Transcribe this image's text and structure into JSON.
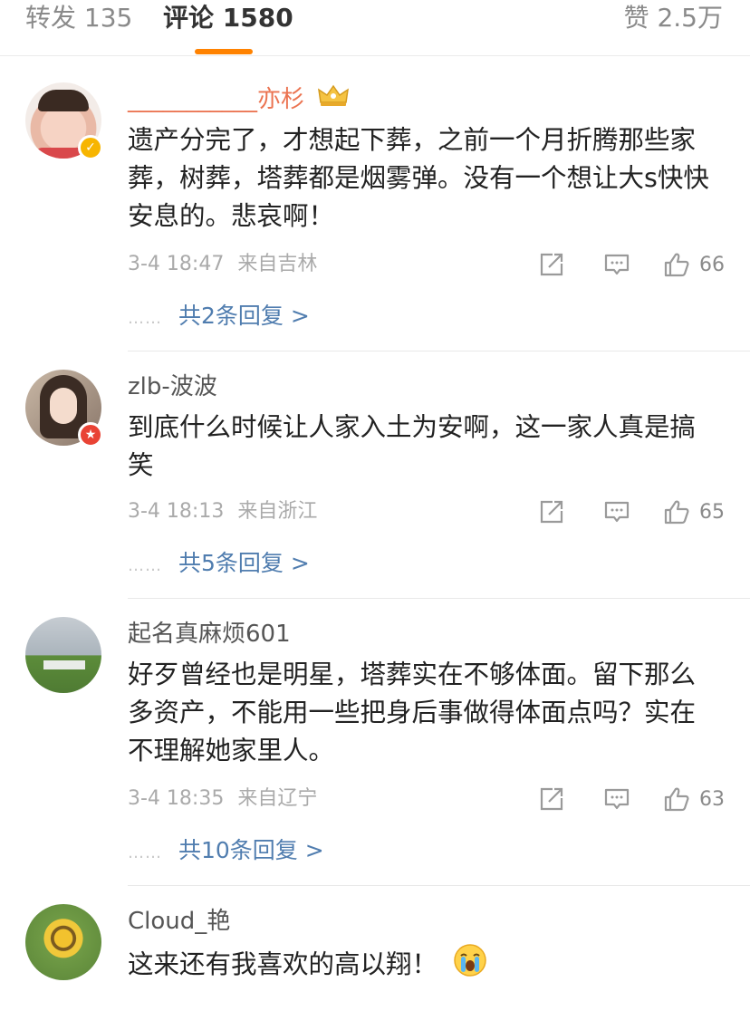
{
  "tabs": {
    "repost": "转发 135",
    "comments": "评论 1580",
    "likes": "赞 2.5万"
  },
  "comments": [
    {
      "user": "___________亦杉",
      "text": "遗产分完了，才想起下葬，之前一个月折腾那些家葬，树葬，塔葬都是烟雾弹。没有一个想让大s快快安息的。悲哀啊！",
      "time": "3-4 18:47",
      "location": "来自吉林",
      "likes": "66",
      "replies": "共2条回复 >",
      "dots": "……"
    },
    {
      "user": "zlb-波波",
      "text": "到底什么时候让人家入土为安啊，这一家人真是搞笑",
      "time": "3-4 18:13",
      "location": "来自浙江",
      "likes": "65",
      "replies": "共5条回复 >",
      "dots": "……"
    },
    {
      "user": "起名真麻烦601",
      "text": "好歹曾经也是明星，塔葬实在不够体面。留下那么多资产，不能用一些把身后事做得体面点吗？实在不理解她家里人。",
      "time": "3-4 18:35",
      "location": "来自辽宁",
      "likes": "63",
      "replies": "共10条回复 >",
      "dots": "……"
    },
    {
      "user": "Cloud_艳",
      "text": "这来还有我喜欢的高以翔！",
      "time": "",
      "location": "",
      "likes": "",
      "replies": "",
      "dots": ""
    }
  ],
  "icons": {
    "share": "share-icon",
    "comment": "comment-icon",
    "like": "thumbs-up-icon",
    "crown": "crown-icon",
    "verified": "verified-badge-icon",
    "crying": "crying-emoji-icon"
  },
  "colors": {
    "accent": "#ff8200",
    "link": "#507daf",
    "vip_name": "#eb7350"
  }
}
